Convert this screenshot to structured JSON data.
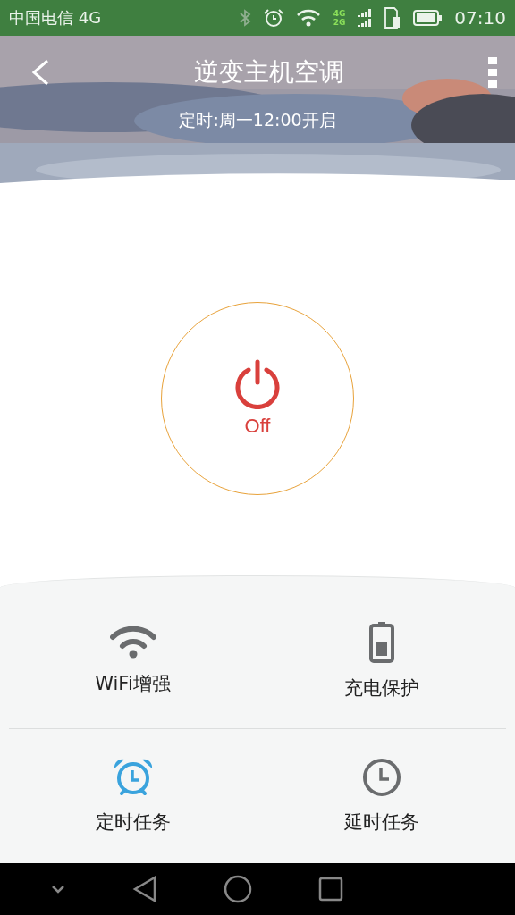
{
  "status_bar": {
    "carrier": "中国电信 4G",
    "network_top": "4G",
    "network_bottom": "2G",
    "time": "07:10"
  },
  "header": {
    "title": "逆变主机空调",
    "subtitle": "定时:周一12:00开启"
  },
  "power": {
    "on": false,
    "label": "Off"
  },
  "tiles": [
    {
      "kind": "wifi",
      "label": "WiFi增强",
      "active": false
    },
    {
      "kind": "battery",
      "label": "充电保护",
      "active": false
    },
    {
      "kind": "alarm",
      "label": "定时任务",
      "active": true
    },
    {
      "kind": "clock",
      "label": "延时任务",
      "active": false
    }
  ]
}
